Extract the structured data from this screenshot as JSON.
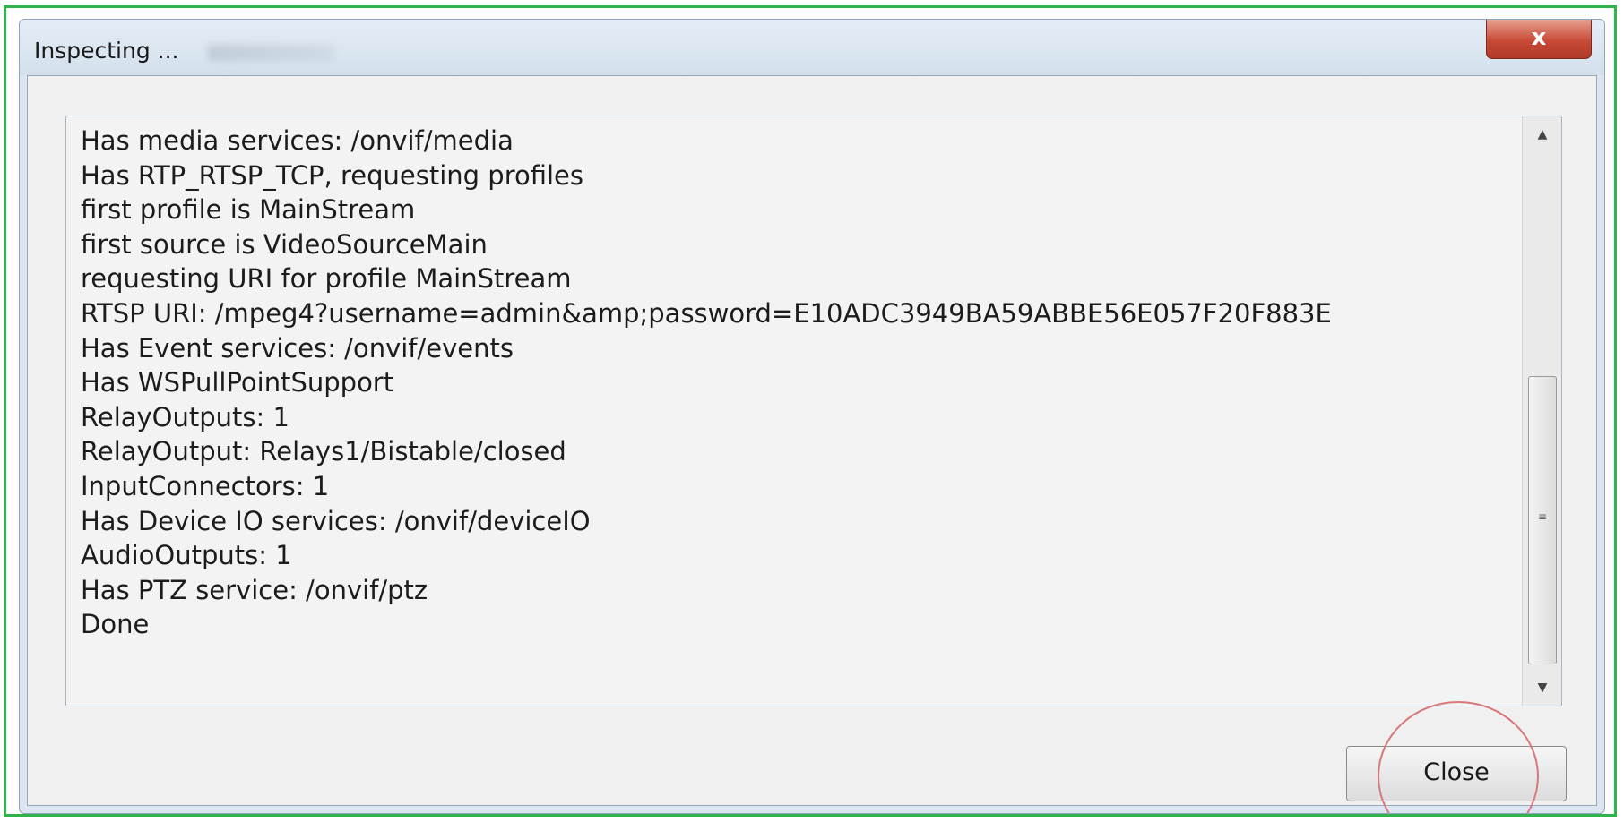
{
  "window": {
    "title": "Inspecting ...",
    "close_glyph": "x"
  },
  "log": {
    "lines": [
      "Has media services: /onvif/media",
      "Has RTP_RTSP_TCP, requesting profiles",
      "first profile is MainStream",
      "first source is VideoSourceMain",
      "requesting URI for profile MainStream",
      "RTSP URI: /mpeg4?username=admin&amp;password=E10ADC3949BA59ABBE56E057F20F883E",
      "Has Event services: /onvif/events",
      "Has WSPullPointSupport",
      "RelayOutputs: 1",
      "RelayOutput: Relays1/Bistable/closed",
      "InputConnectors: 1",
      "Has Device IO services: /onvif/deviceIO",
      "AudioOutputs: 1",
      "Has PTZ service: /onvif/ptz",
      "Done"
    ]
  },
  "scrollbar": {
    "up_glyph": "▲",
    "down_glyph": "▼",
    "grip_glyph": "≡",
    "position": 0.67
  },
  "buttons": {
    "close_label": "Close"
  },
  "colors": {
    "frame_border": "#2fb34a",
    "highlight_circle": "#d9787a",
    "close_x_red": "#c84a36"
  }
}
